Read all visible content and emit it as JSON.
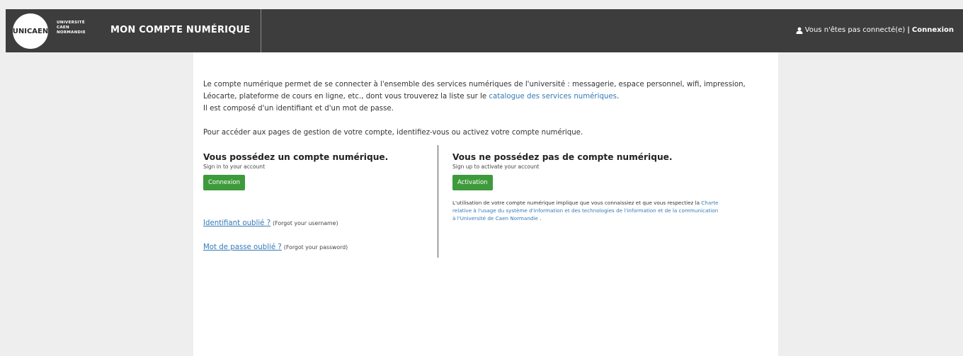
{
  "header": {
    "logo_mark": "UNICAEN",
    "logo_lines": [
      "UNIVERSITÉ",
      "CAEN",
      "NORMANDIE"
    ],
    "title": "MON COMPTE NUMÉRIQUE",
    "not_connected": "Vous n'êtes pas connecté(e)",
    "separator": "|",
    "login_link": "Connexion"
  },
  "intro": {
    "text1_a": "Le compte numérique permet de se connecter à l'ensemble des services numériques de l'université : messagerie, espace personnel, wifi, impression, Léocarte, plateforme de cours en ligne, etc., dont vous trouverez la liste sur le ",
    "catalog_link": "catalogue des services numériques",
    "text1_b": ".",
    "text2": "Il est composé d'un identifiant et d'un mot de passe.",
    "text3": "Pour accéder aux pages de gestion de votre compte, identifiez-vous ou activez votre compte numérique."
  },
  "left": {
    "title": "Vous possédez un compte numérique.",
    "subtitle": "Sign in to your account",
    "button": "Connexion",
    "forgot_username": "Identifiant oublié ?",
    "forgot_username_hint": "(Forgot your username)",
    "forgot_password": "Mot de passe oublié ?",
    "forgot_password_hint": "(Forgot your password)"
  },
  "right": {
    "title": "Vous ne possédez pas de compte numérique.",
    "subtitle": "Sign up to activate your account",
    "button": "Activation",
    "charter_text_a": "L'utilisation de votre compte numérique implique que vous connaissiez et que vous respectiez la ",
    "charter_link": "Charte relative à l'usage du système d'information et des technologies de l'information et de la communication à l'Université de Caen Normandie",
    "charter_text_b": " ."
  },
  "colors": {
    "topbar": "#3d3d3d",
    "button_green": "#3e9b3b",
    "link_blue": "#337ab7",
    "page_bg": "#eeeeee"
  },
  "icons": {
    "user": "user-icon"
  }
}
